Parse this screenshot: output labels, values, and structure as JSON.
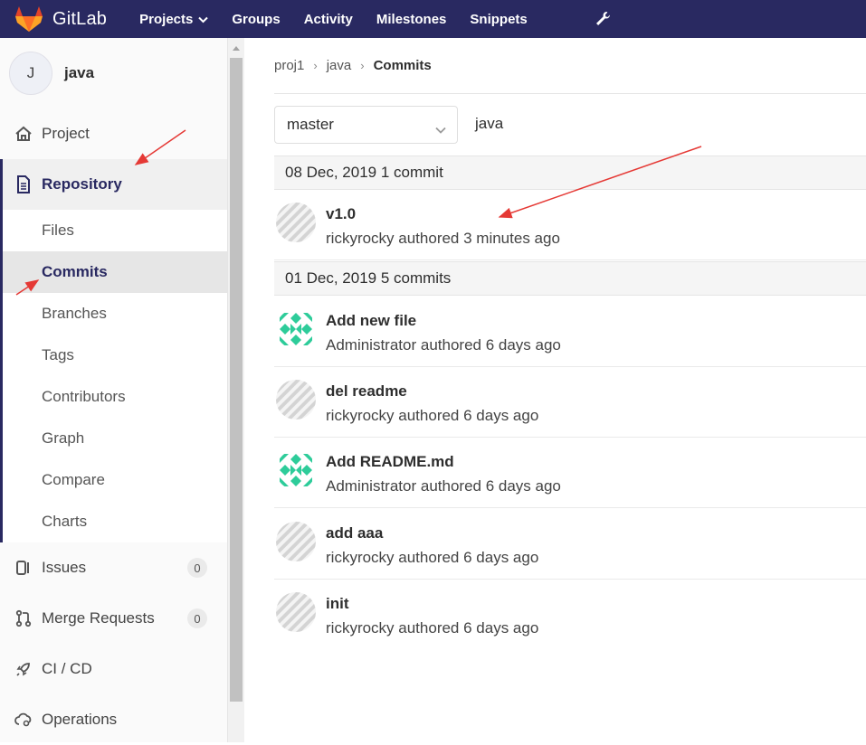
{
  "navbar": {
    "brand": "GitLab",
    "links": [
      {
        "label": "Projects"
      },
      {
        "label": "Groups"
      },
      {
        "label": "Activity"
      },
      {
        "label": "Milestones"
      },
      {
        "label": "Snippets"
      }
    ],
    "icons": {
      "logo": "gitlab-tanuki-icon",
      "admin": "wrench-icon",
      "projects_dropdown": "chevron-down-icon"
    },
    "color": "#292961"
  },
  "sidebar": {
    "avatar_letter": "J",
    "project_name": "java",
    "items": [
      {
        "label": "Project",
        "icon": "home-icon"
      },
      {
        "label": "Repository",
        "icon": "document-icon"
      },
      {
        "label": "Issues",
        "icon": "issues-icon",
        "count": "0"
      },
      {
        "label": "Merge Requests",
        "icon": "merge-request-icon",
        "count": "0"
      },
      {
        "label": "CI / CD",
        "icon": "rocket-icon"
      },
      {
        "label": "Operations",
        "icon": "cloud-gear-icon"
      }
    ],
    "repository_sub": [
      "Files",
      "Commits",
      "Branches",
      "Tags",
      "Contributors",
      "Graph",
      "Compare",
      "Charts"
    ],
    "current_sub": "Commits"
  },
  "breadcrumb": [
    "proj1",
    "java",
    "Commits"
  ],
  "branch": {
    "selected": "master",
    "path": "java"
  },
  "days": [
    {
      "header": "08 Dec, 2019 1 commit",
      "commits": [
        {
          "title": "v1.0",
          "meta": "rickyrocky authored 3 minutes ago",
          "avatar": "gray"
        }
      ]
    },
    {
      "header": "01 Dec, 2019 5 commits",
      "commits": [
        {
          "title": "Add new file",
          "meta": "Administrator authored 6 days ago",
          "avatar": "green"
        },
        {
          "title": "del readme",
          "meta": "rickyrocky authored 6 days ago",
          "avatar": "gray"
        },
        {
          "title": "Add README.md",
          "meta": "Administrator authored 6 days ago",
          "avatar": "green"
        },
        {
          "title": "add aaa",
          "meta": "rickyrocky authored 6 days ago",
          "avatar": "gray"
        },
        {
          "title": "init",
          "meta": "rickyrocky authored 6 days ago",
          "avatar": "gray"
        }
      ]
    }
  ],
  "colors": {
    "accent": "#292961",
    "identicon_green": "#2ecc9a",
    "identicon_gray": "#d4d4d4",
    "annotation": "#e53935"
  }
}
